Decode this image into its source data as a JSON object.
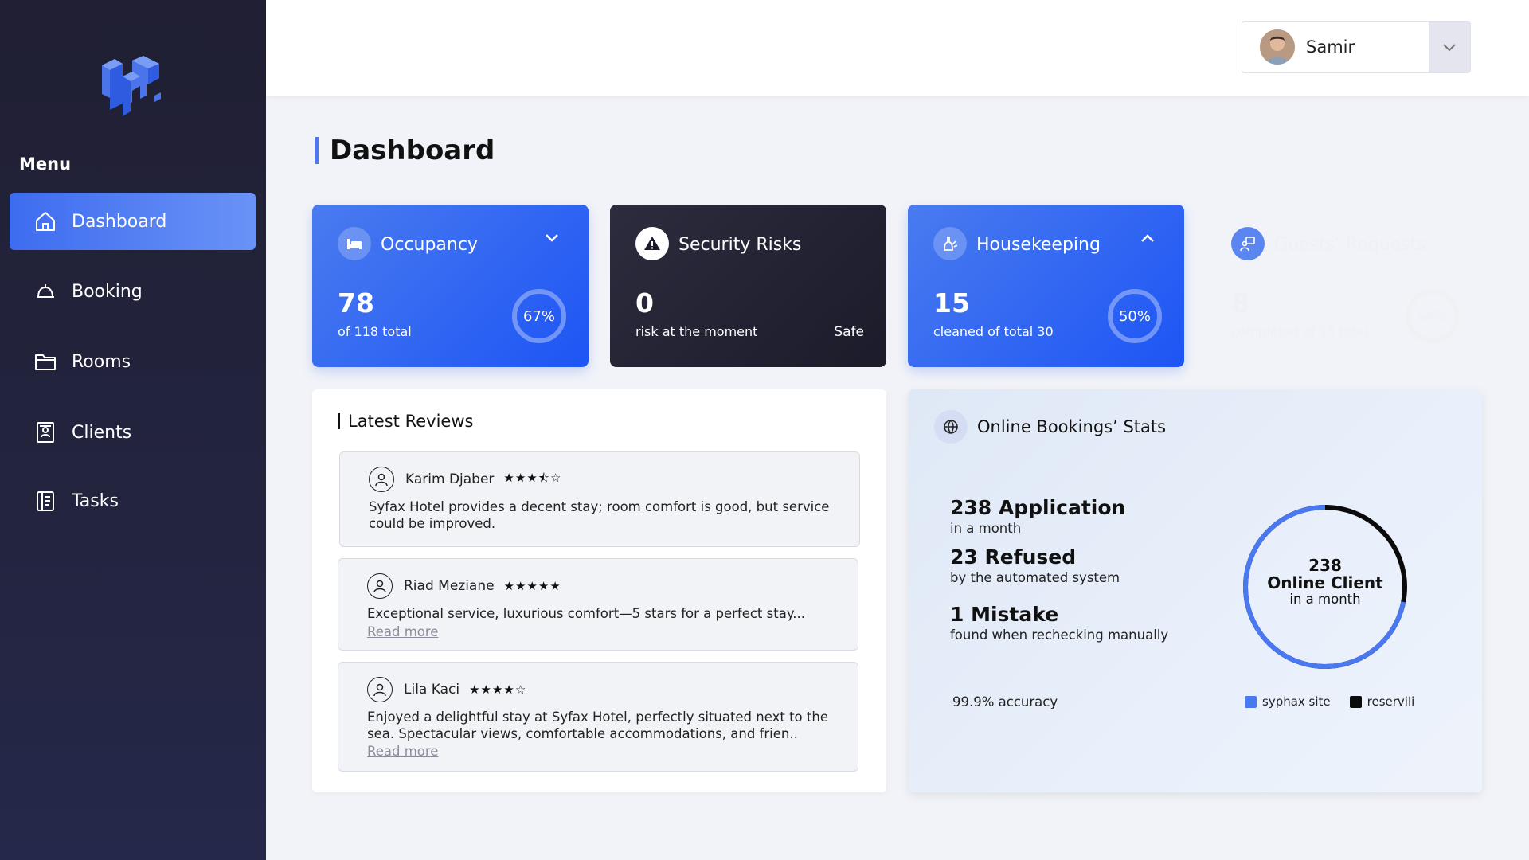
{
  "sidebar": {
    "menu_heading": "Menu",
    "items": [
      {
        "label": "Dashboard",
        "icon": "home-icon",
        "active": true
      },
      {
        "label": "Booking",
        "icon": "bell-icon",
        "active": false
      },
      {
        "label": "Rooms",
        "icon": "folder-icon",
        "active": false
      },
      {
        "label": "Clients",
        "icon": "contact-book-icon",
        "active": false
      },
      {
        "label": "Tasks",
        "icon": "notepad-icon",
        "active": false
      }
    ]
  },
  "header": {
    "user_name": "Samir"
  },
  "page": {
    "title": "Dashboard"
  },
  "cards": [
    {
      "title": "Occupancy",
      "value": "78",
      "sub": "of 118 total",
      "ring": "67%",
      "icon": "bed-icon",
      "chevron": "chevron-down-icon"
    },
    {
      "title": "Security Risks",
      "value": "0",
      "sub": "risk at the moment",
      "status": "Safe",
      "icon": "warning-icon"
    },
    {
      "title": "Housekeeping",
      "value": "15",
      "sub": "cleaned of total 30",
      "ring": "50%",
      "icon": "cleaning-icon",
      "chevron": "chevron-up-icon"
    },
    {
      "title": "Guests’ Requests",
      "value": "8",
      "sub": "completed of 15 total",
      "ring": "54%",
      "icon": "request-icon"
    }
  ],
  "reviews": {
    "title": "Latest Reviews",
    "items": [
      {
        "name": "Karim Djaber",
        "stars": "★★★⯪☆",
        "rating": 3.5,
        "text": "Syfax Hotel provides a decent stay; room comfort is good, but service could be improved.",
        "more": ""
      },
      {
        "name": "Riad Meziane",
        "stars": "★★★★★",
        "rating": 5,
        "text": "Exceptional service, luxurious comfort—5 stars for a perfect stay...",
        "more": "Read more"
      },
      {
        "name": "Lila Kaci",
        "stars": "★★★★☆",
        "rating": 4,
        "text": "Enjoyed a delightful stay at Syfax Hotel, perfectly situated next to the sea. Spectacular views, comfortable accommodations, and frien..",
        "more": "Read more"
      }
    ]
  },
  "stats": {
    "title": "Online Bookings’ Stats",
    "rows": [
      {
        "big": "238 Application",
        "small": "in a month"
      },
      {
        "big": "23 Refused",
        "small": "by the automated system"
      },
      {
        "big": "1 Mistake",
        "small": "found when rechecking manually"
      }
    ],
    "accuracy": "99.9% accuracy",
    "donut": {
      "value": "238",
      "label": "Online Client",
      "period": "in a month",
      "syphax_fraction": 0.72
    },
    "legend": [
      {
        "label": "syphax site",
        "color": "#4a78f0"
      },
      {
        "label": "reservili",
        "color": "#0b0b0b"
      }
    ]
  },
  "colors": {
    "accent": "#3d6cf0",
    "sidebar_bg": "#201f33",
    "card_blue": "#1d55f5",
    "card_dark": "#1b1b2a"
  }
}
